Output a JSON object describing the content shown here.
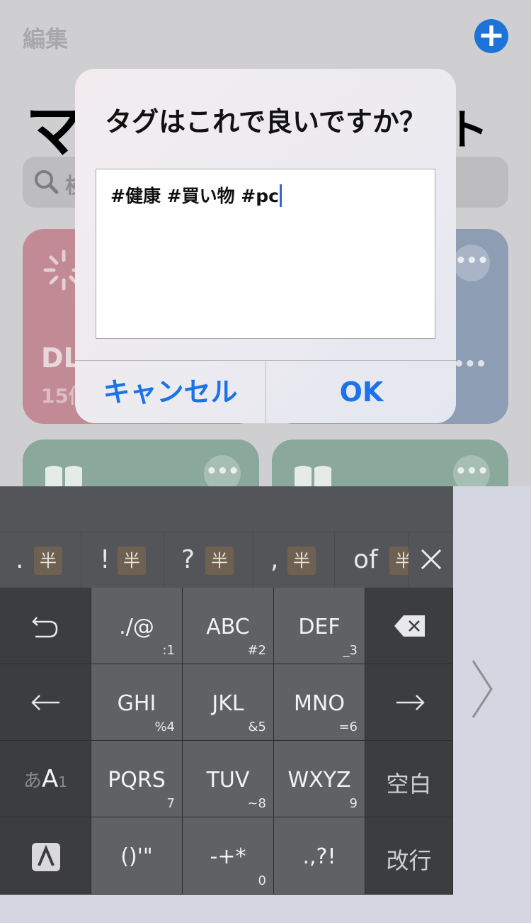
{
  "background": {
    "edit_label": "編集",
    "title_partial": "マ",
    "title_tail": "ト",
    "search_placeholder_partial": "検",
    "card_dl": {
      "title": "DL",
      "subtitle": "15個"
    },
    "more_glyph": "•••"
  },
  "alert": {
    "title": "タグはこれで良いですか？",
    "field_value": "#健康 #買い物 #pc",
    "cancel_label": "キャンセル",
    "ok_label": "OK"
  },
  "keyboard": {
    "candidates": [
      {
        "text": ".",
        "badge": "半"
      },
      {
        "text": "!",
        "badge": "半"
      },
      {
        "text": "?",
        "badge": "半"
      },
      {
        "text": ",",
        "badge": "半"
      },
      {
        "text": "of",
        "badge": "半"
      }
    ],
    "keys": {
      "punct": {
        "main": "./@",
        "sub": ":1"
      },
      "abc": {
        "main": "ABC",
        "sub": "#2"
      },
      "def": {
        "main": "DEF",
        "sub": "_3"
      },
      "ghi": {
        "main": "GHI",
        "sub": "%4"
      },
      "jkl": {
        "main": "JKL",
        "sub": "&5"
      },
      "mno": {
        "main": "MNO",
        "sub": "=6"
      },
      "pqrs": {
        "main": "PQRS",
        "sub": "7"
      },
      "tuv": {
        "main": "TUV",
        "sub": "~8"
      },
      "wxyz": {
        "main": "WXYZ",
        "sub": "9"
      },
      "brackets": {
        "main": "()'\"",
        "sub": ""
      },
      "ops": {
        "main": "-+*",
        "sub": "0"
      },
      "punct2": {
        "main": ".,?!",
        "sub": ""
      },
      "mode_a": "あ",
      "mode_b": "A",
      "mode_c": "1",
      "space": "空白",
      "return": "改行"
    }
  },
  "colors": {
    "accent": "#1a73e8",
    "add_button": "#1e73d8",
    "caret": "#2f66e0"
  }
}
